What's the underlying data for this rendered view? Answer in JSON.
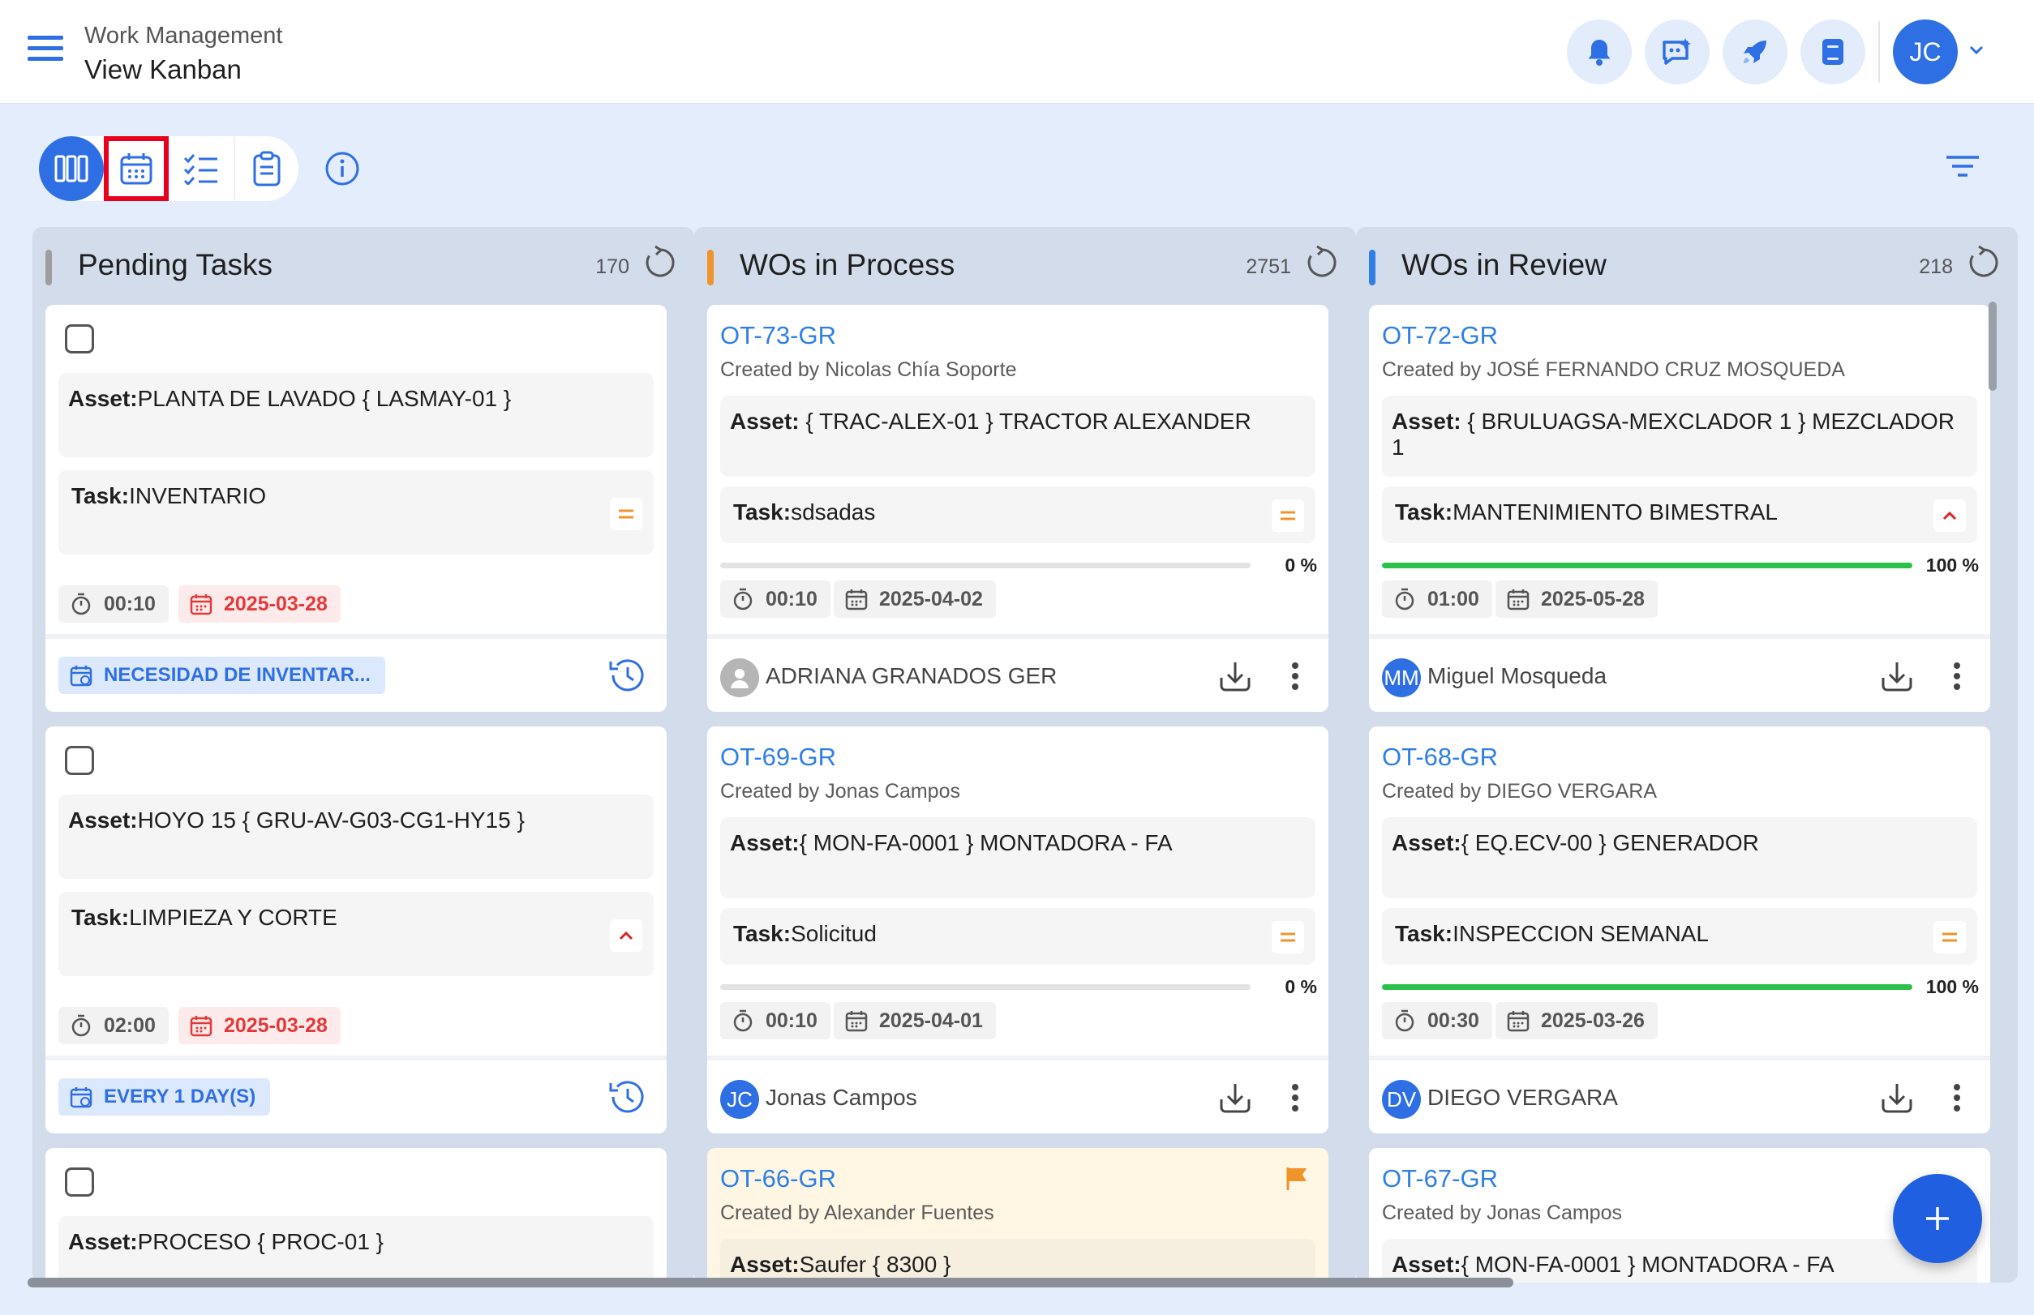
{
  "header": {
    "module": "Work Management",
    "page_title": "View Kanban",
    "avatar_initials": "JC"
  },
  "columns": [
    {
      "title": "Pending Tasks",
      "count": "170",
      "color": "#9e9e9e",
      "cards": [
        {
          "asset_label": "Asset:",
          "asset": "PLANTA DE LAVADO { LASMAY-01 }",
          "task_label": "Task:",
          "task": "INVENTARIO",
          "priority": "equal",
          "time": "00:10",
          "date": "2025-03-28",
          "tag": "NECESIDAD DE INVENTAR..."
        },
        {
          "asset_label": "Asset:",
          "asset": "HOYO 15 { GRU-AV-G03-CG1-HY15 }",
          "task_label": "Task:",
          "task": "LIMPIEZA Y CORTE",
          "priority": "high",
          "time": "02:00",
          "date": "2025-03-28",
          "tag": "EVERY 1 DAY(S)"
        },
        {
          "asset_label": "Asset:",
          "asset": "PROCESO { PROC-01 }"
        }
      ]
    },
    {
      "title": "WOs in Process",
      "count": "2751",
      "color": "#f0932b",
      "cards": [
        {
          "id": "OT-73-GR",
          "created_by": "Created by Nicolas Chía Soporte",
          "asset_label": "Asset:",
          "asset": " { TRAC-ALEX-01 } TRACTOR ALEXANDER",
          "task_label": "Task:",
          "task": "sdsadas",
          "priority": "equal",
          "progress": 0,
          "progress_label": "0 %",
          "time": "00:10",
          "date": "2025-04-02",
          "assignee": "ADRIANA GRANADOS GER",
          "assignee_initials": ""
        },
        {
          "id": "OT-69-GR",
          "created_by": "Created by Jonas Campos",
          "asset_label": "Asset:",
          "asset": "{ MON-FA-0001 } MONTADORA - FA",
          "task_label": "Task:",
          "task": "Solicitud",
          "priority": "equal",
          "progress": 0,
          "progress_label": "0 %",
          "time": "00:10",
          "date": "2025-04-01",
          "assignee": "Jonas Campos",
          "assignee_initials": "JC"
        },
        {
          "id": "OT-66-GR",
          "created_by": "Created by Alexander Fuentes",
          "asset_label": "Asset:",
          "asset": "Saufer { 8300 }",
          "flagged": true
        }
      ]
    },
    {
      "title": "WOs in Review",
      "count": "218",
      "color": "#2f7fe4",
      "cards": [
        {
          "id": "OT-72-GR",
          "created_by": "Created by JOSÉ FERNANDO CRUZ MOSQUEDA",
          "asset_label": "Asset:",
          "asset": " { BRULUAGSA-MEXCLADOR 1 } MEZCLADOR 1",
          "task_label": "Task:",
          "task": "MANTENIMIENTO BIMESTRAL",
          "priority": "high",
          "progress": 100,
          "progress_label": "100 %",
          "time": "01:00",
          "date": "2025-05-28",
          "assignee": "Miguel Mosqueda",
          "assignee_initials": "MM"
        },
        {
          "id": "OT-68-GR",
          "created_by": "Created by DIEGO VERGARA",
          "asset_label": "Asset:",
          "asset": "{ EQ.ECV-00 } GENERADOR",
          "task_label": "Task:",
          "task": "INSPECCION SEMANAL",
          "priority": "equal",
          "progress": 100,
          "progress_label": "100 %",
          "time": "00:30",
          "date": "2025-03-26",
          "assignee": "DIEGO VERGARA",
          "assignee_initials": "DV"
        },
        {
          "id": "OT-67-GR",
          "created_by": "Created by Jonas Campos",
          "asset_label": "Asset:",
          "asset": "{ MON-FA-0001 } MONTADORA - FA"
        }
      ]
    }
  ],
  "colors": {
    "accent": "#2f6fe4",
    "highlight_box": "#e8001c",
    "progress": "#2ac04a",
    "priority_equal": "#f0932b",
    "priority_high": "#d62828",
    "date_overdue": "#e23a3a"
  },
  "icons": [
    "menu-icon",
    "bell-icon",
    "chat-sparkle-icon",
    "rocket-icon",
    "book-icon",
    "chevron-down-icon",
    "kanban-icon",
    "calendar-icon",
    "checklist-icon",
    "clipboard-icon",
    "info-icon",
    "filter-icon",
    "refresh-icon",
    "stopwatch-icon",
    "calendar-small-icon",
    "calendar-tag-icon",
    "history-icon",
    "download-icon",
    "kebab-icon",
    "flag-icon",
    "plus-icon"
  ]
}
